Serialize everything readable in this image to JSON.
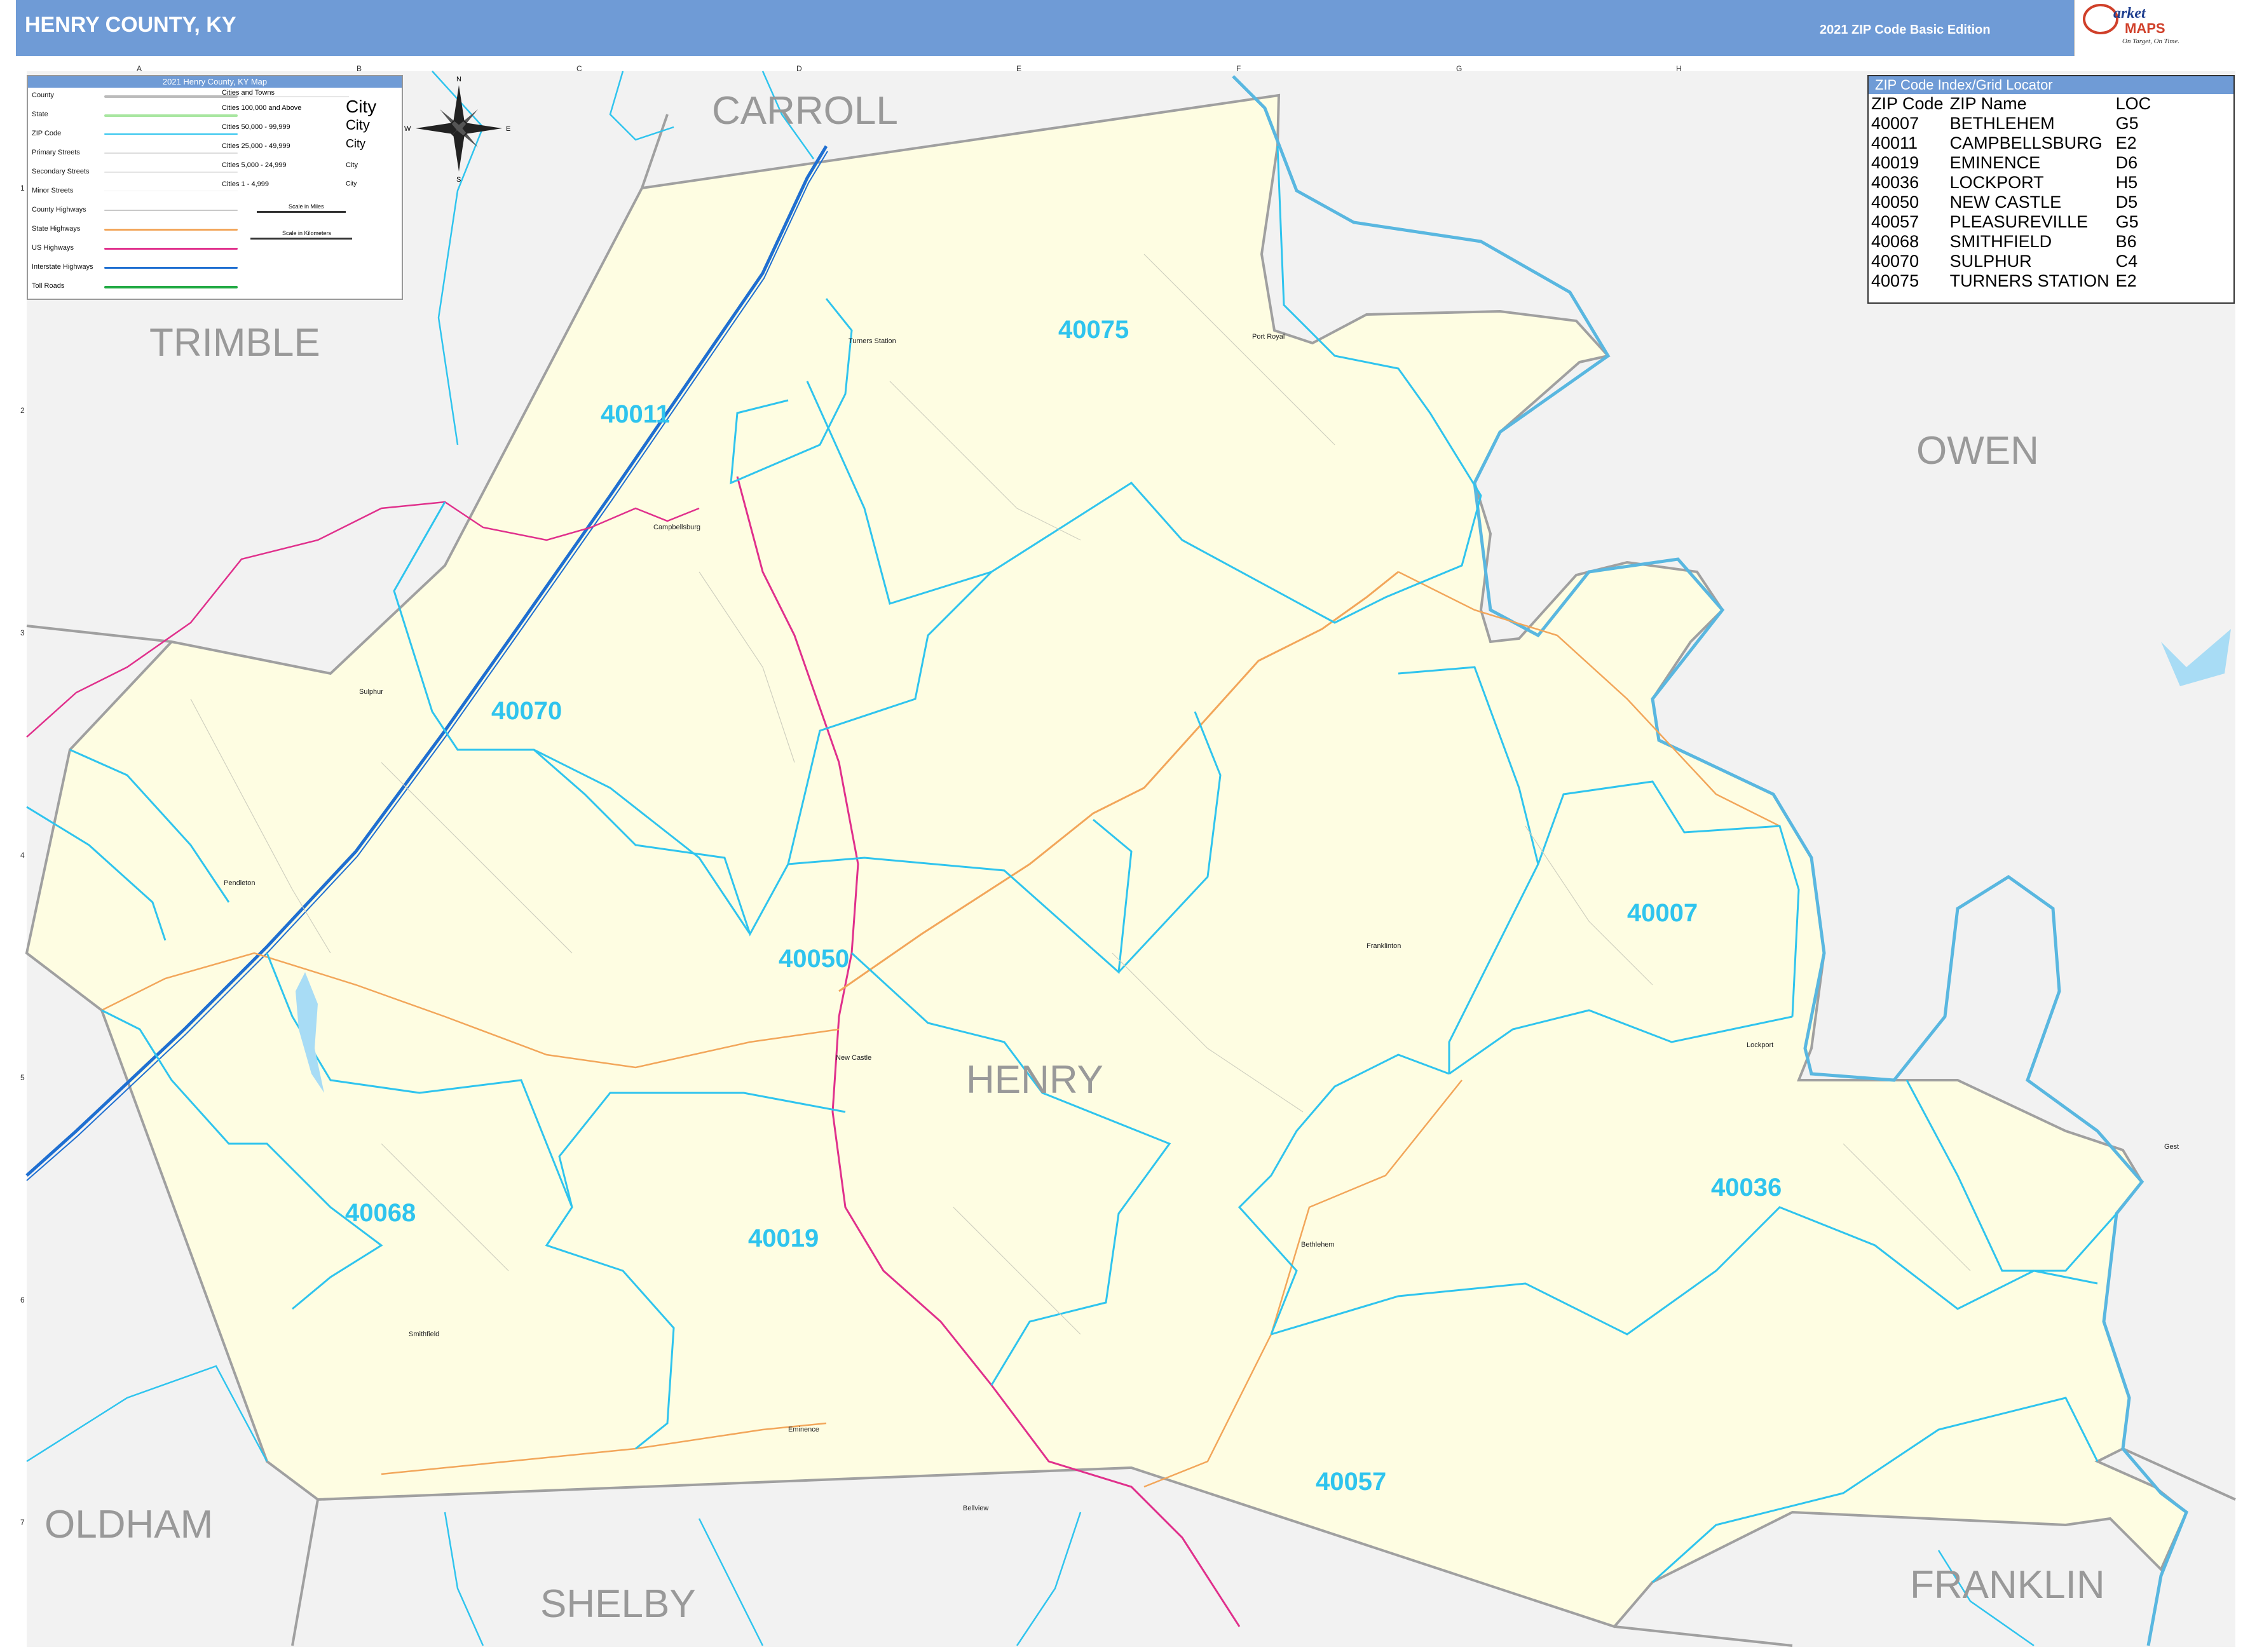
{
  "header": {
    "title": "HENRY COUNTY, KY",
    "edition": "2021 ZIP Code Basic Edition",
    "logo_brand_top": "arket",
    "logo_brand_bottom": "MAPS",
    "logo_tagline": "On Target, On Time."
  },
  "legend": {
    "title": "2021 Henry County, KY Map",
    "items": [
      {
        "label": "County",
        "color": "#bbbbbb"
      },
      {
        "label": "State",
        "color": "#a8e6a0"
      },
      {
        "label": "ZIP Code",
        "color": "#2fc4ee"
      },
      {
        "label": "Primary Streets",
        "color": "#dddddd"
      },
      {
        "label": "Secondary Streets",
        "color": "#e4e4e4"
      },
      {
        "label": "Minor Streets",
        "color": "#eeeeee"
      },
      {
        "label": "County Highways",
        "color": "#c8c8c8"
      },
      {
        "label": "State Highways",
        "color": "#f2a65a"
      },
      {
        "label": "US Highways",
        "color": "#e0308c"
      },
      {
        "label": "Interstate Highways",
        "color": "#1f6fd1"
      },
      {
        "label": "Toll Roads",
        "color": "#22aa44"
      }
    ],
    "cities_header": "Cities and Towns",
    "city_sizes": [
      {
        "range": "Cities 100,000 and Above",
        "sample": "City"
      },
      {
        "range": "Cities 50,000 - 99,999",
        "sample": "City"
      },
      {
        "range": "Cities 25,000 - 49,999",
        "sample": "City"
      },
      {
        "range": "Cities 5,000 - 24,999",
        "sample": "City"
      },
      {
        "range": "Cities 1 - 4,999",
        "sample": "City"
      }
    ],
    "scale_miles": "Scale in Miles",
    "scale_km": "Scale in Kilometers"
  },
  "compass": {
    "n": "N",
    "e": "E",
    "s": "S",
    "w": "W"
  },
  "zip_index": {
    "title": "ZIP Code Index/Grid Locator",
    "headers": [
      "ZIP Code",
      "ZIP Name",
      "LOC"
    ],
    "rows": [
      [
        "40007",
        "BETHLEHEM",
        "G5"
      ],
      [
        "40011",
        "CAMPBELLSBURG",
        "E2"
      ],
      [
        "40019",
        "EMINENCE",
        "D6"
      ],
      [
        "40036",
        "LOCKPORT",
        "H5"
      ],
      [
        "40050",
        "NEW CASTLE",
        "D5"
      ],
      [
        "40057",
        "PLEASUREVILLE",
        "G5"
      ],
      [
        "40068",
        "SMITHFIELD",
        "B6"
      ],
      [
        "40070",
        "SULPHUR",
        "C4"
      ],
      [
        "40075",
        "TURNERS STATION",
        "E2"
      ]
    ]
  },
  "counties": {
    "carroll": "CARROLL",
    "trimble": "TRIMBLE",
    "owen": "OWEN",
    "oldham": "OLDHAM",
    "shelby": "SHELBY",
    "franklin": "FRANKLIN",
    "henry": "HENRY"
  },
  "zips": {
    "z40075": "40075",
    "z40011": "40011",
    "z40070": "40070",
    "z40050": "40050",
    "z40007": "40007",
    "z40036": "40036",
    "z40068": "40068",
    "z40019": "40019",
    "z40057": "40057"
  },
  "towns": {
    "turners_station": "Turners Station",
    "port_royal": "Port Royal",
    "campbellsburg": "Campbellsburg",
    "sulphur": "Sulphur",
    "pendleton": "Pendleton",
    "new_castle": "New Castle",
    "franklinton": "Franklinton",
    "lockport": "Lockport",
    "bethlehem": "Bethlehem",
    "smithfield": "Smithfield",
    "eminence": "Eminence",
    "bellview": "Bellview",
    "gest": "Gest"
  },
  "grid": {
    "cols": [
      "A",
      "B",
      "C",
      "D",
      "E",
      "F",
      "G",
      "H"
    ],
    "rows": [
      "1",
      "2",
      "3",
      "4",
      "5",
      "6",
      "7"
    ]
  },
  "colors": {
    "header": "#6f9bd6",
    "county_fill": "#fefde2",
    "outside_fill": "#f2f2f2",
    "zip_line": "#2fc4ee",
    "us_highway": "#e0308c",
    "interstate": "#1f6fd1",
    "state_highway": "#f2a65a",
    "county_border": "#a0a0a0"
  }
}
